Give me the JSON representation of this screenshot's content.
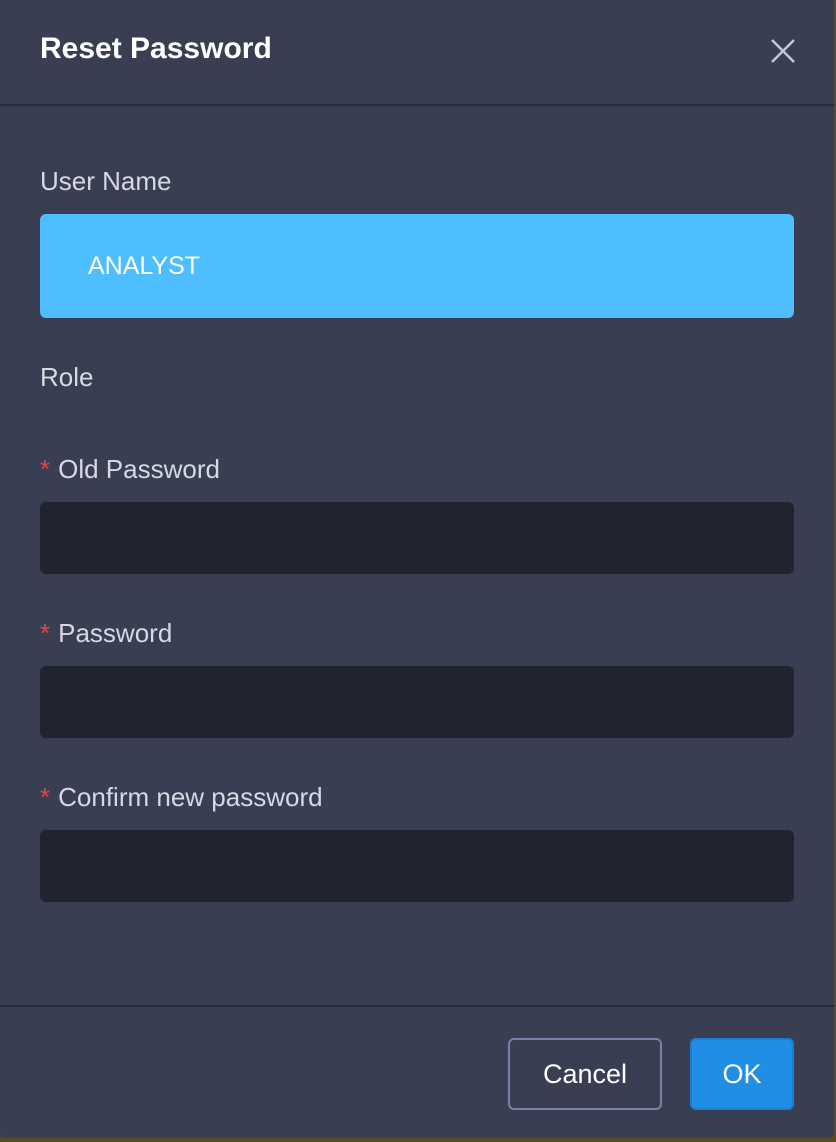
{
  "dialog": {
    "title": "Reset Password",
    "close_icon": "close-x-icon",
    "fields": {
      "user_name_label": "User Name",
      "user_name_value": "ANALYST",
      "role_label": "Role",
      "old_password_label": "Old Password",
      "password_label": "Password",
      "confirm_label": "Confirm new password",
      "required_marker": "*"
    },
    "buttons": {
      "cancel": "Cancel",
      "ok": "OK"
    },
    "colors": {
      "background": "#3a3e52",
      "highlight": "#4fbefe",
      "primary": "#218ee6",
      "required": "#e0474c"
    }
  }
}
